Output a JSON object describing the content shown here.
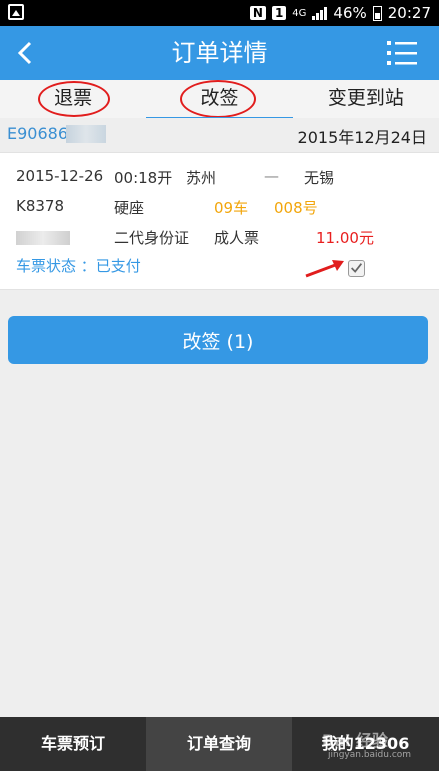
{
  "status_bar": {
    "network": "4G",
    "battery": "46%",
    "time": "20:27",
    "sim_badge": "1",
    "notif_badge": "N"
  },
  "header": {
    "title": "订单详情",
    "back_icon": "chevron-left-icon",
    "menu_icon": "hamburger-menu-icon"
  },
  "tabs": [
    {
      "label": "退票",
      "active": false
    },
    {
      "label": "改签",
      "active": true
    },
    {
      "label": "变更到站",
      "active": false
    }
  ],
  "order": {
    "number_visible": "E90686",
    "date": "2015年12月24日"
  },
  "ticket": {
    "date": "2015-12-26",
    "depart_time": "00:18开",
    "from": "苏州",
    "separator": "—",
    "to": "无锡",
    "train": "K8378",
    "seat_class": "硬座",
    "car": "09车",
    "seat_no": "008号",
    "id_type": "二代身份证",
    "ticket_type": "成人票",
    "price": "11.00元",
    "status": "车票状态 ：已支付",
    "checked": true
  },
  "actions": {
    "resign_button": "改签 (1)"
  },
  "bottom_nav": [
    {
      "label": "车票预订",
      "active": false
    },
    {
      "label": "订单查询",
      "active": true
    },
    {
      "label": "我的12306",
      "active": false
    }
  ],
  "watermark": {
    "main": "Bai 经验",
    "sub": "jingyan.baidu.com"
  },
  "colors": {
    "primary": "#3598e4",
    "accent_orange": "#f2a60c",
    "price_red": "#e81f1f",
    "annotation_red": "#e11d1d"
  }
}
